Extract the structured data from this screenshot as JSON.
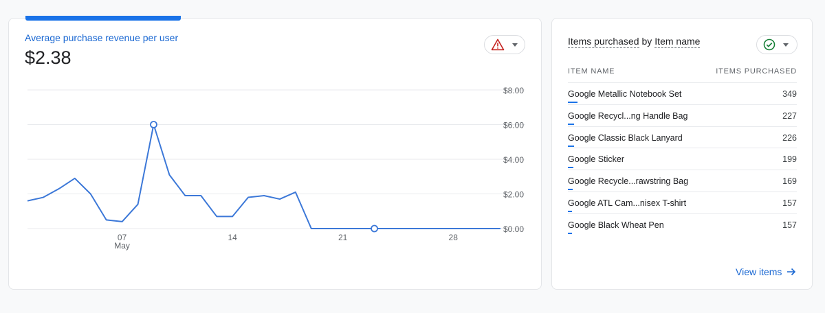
{
  "metric_card": {
    "title": "Average purchase revenue per user",
    "value": "$2.38",
    "status_icon": "warning-icon",
    "status_color": "#c5221f"
  },
  "chart_data": {
    "type": "line",
    "x_tick_labels": [
      {
        "day": 7,
        "label": "07",
        "sub": "May"
      },
      {
        "day": 14,
        "label": "14",
        "sub": ""
      },
      {
        "day": 21,
        "label": "21",
        "sub": ""
      },
      {
        "day": 28,
        "label": "28",
        "sub": ""
      }
    ],
    "y_tick_labels": [
      "$8.00",
      "$6.00",
      "$4.00",
      "$2.00",
      "$0.00"
    ],
    "ylim": [
      0,
      8
    ],
    "xlim": [
      1,
      31
    ],
    "x": [
      1,
      2,
      3,
      4,
      5,
      6,
      7,
      8,
      9,
      10,
      11,
      12,
      13,
      14,
      15,
      16,
      17,
      18,
      19,
      20,
      21,
      22,
      23,
      24,
      25,
      26,
      27,
      28,
      29,
      30,
      31
    ],
    "values": [
      1.6,
      1.8,
      2.3,
      2.9,
      2.0,
      0.5,
      0.4,
      1.4,
      6.0,
      3.1,
      1.9,
      1.9,
      0.7,
      0.7,
      1.8,
      1.9,
      1.7,
      2.1,
      0,
      0,
      0,
      0,
      0,
      0,
      0,
      0,
      0,
      0,
      0,
      0,
      0
    ],
    "markers": [
      9,
      23
    ],
    "line_color": "#3c78d8",
    "grid": true
  },
  "items_card": {
    "title_part1": "Items purchased",
    "title_mid": "by",
    "title_part2": "Item name",
    "status_icon": "check-circle-icon",
    "status_color": "#188038",
    "col_item": "ITEM NAME",
    "col_value": "ITEMS PURCHASED",
    "rows": [
      {
        "name": "Google Metallic Notebook Set",
        "value": "349"
      },
      {
        "name": "Google Recycl...ng Handle Bag",
        "value": "227"
      },
      {
        "name": "Google Classic Black Lanyard",
        "value": "226"
      },
      {
        "name": "Google Sticker",
        "value": "199"
      },
      {
        "name": "Google Recycle...rawstring Bag",
        "value": "169"
      },
      {
        "name": "Google ATL Cam...nisex T-shirt",
        "value": "157"
      },
      {
        "name": "Google Black Wheat Pen",
        "value": "157"
      }
    ],
    "link_label": "View items",
    "link_icon": "arrow-right-icon"
  }
}
